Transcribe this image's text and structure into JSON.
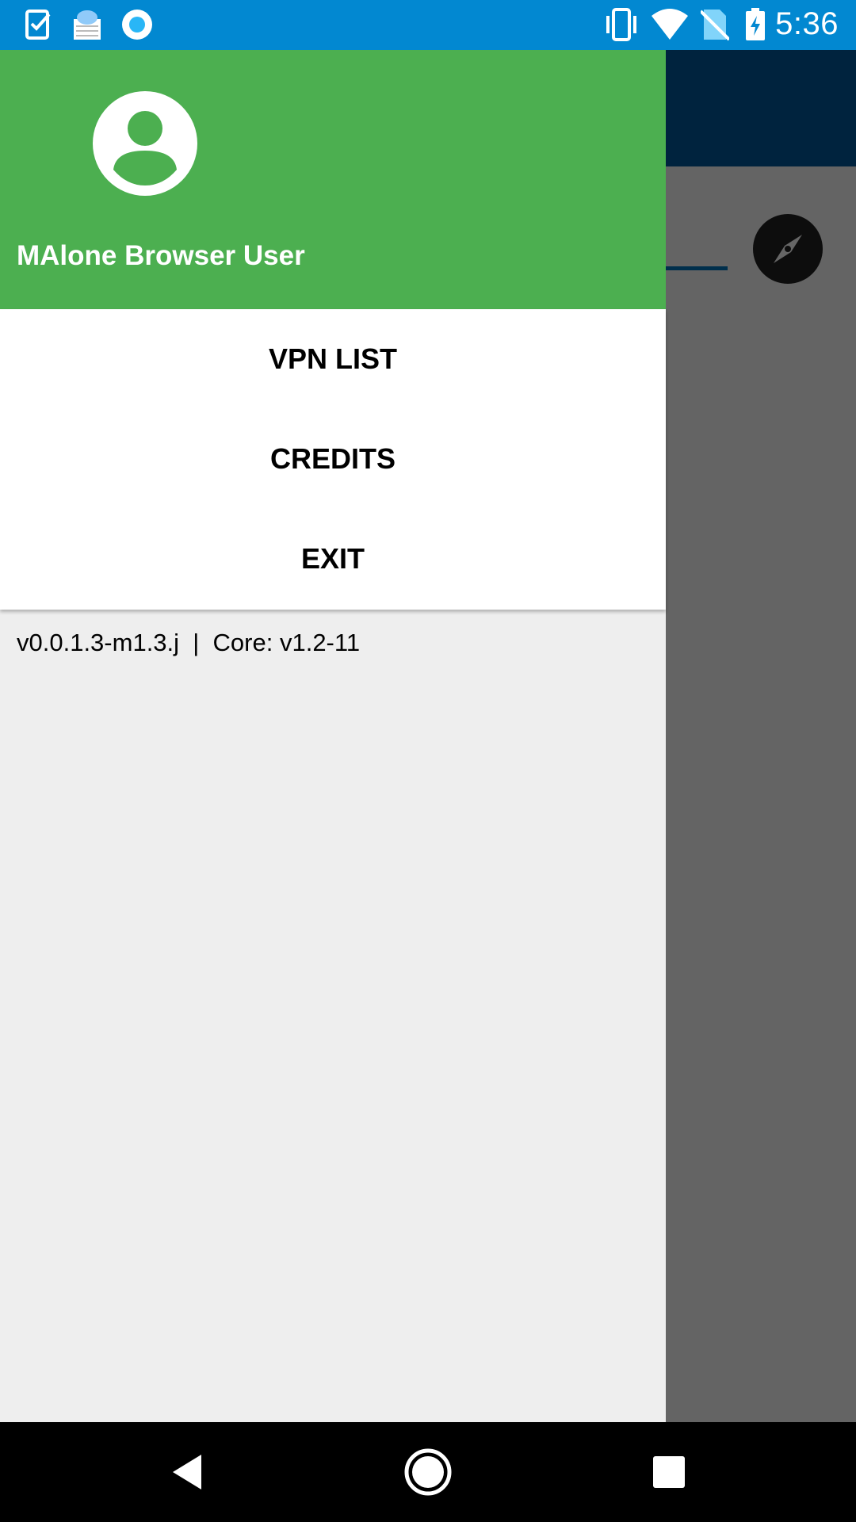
{
  "status_bar": {
    "time": "5:36",
    "left_icons": [
      "clipboard-check-icon",
      "weather-cloud-icon",
      "circle-sync-icon"
    ],
    "right_icons": [
      "vibrate-icon",
      "wifi-icon",
      "no-sim-icon",
      "battery-charging-icon"
    ]
  },
  "drawer": {
    "user_name": "MAlone Browser User",
    "menu": [
      {
        "label": "VPN LIST"
      },
      {
        "label": "CREDITS"
      },
      {
        "label": "EXIT"
      }
    ],
    "version_text": "v0.0.1.3-m1.3.j  |  Core: v1.2-11"
  },
  "background": {
    "compass_icon": "compass-icon"
  },
  "nav_bar": {
    "buttons": [
      "back-icon",
      "home-icon",
      "recents-icon"
    ]
  },
  "colors": {
    "status_bar": "#0288d1",
    "drawer_header": "#4caf50",
    "toolbar": "#01579b"
  }
}
